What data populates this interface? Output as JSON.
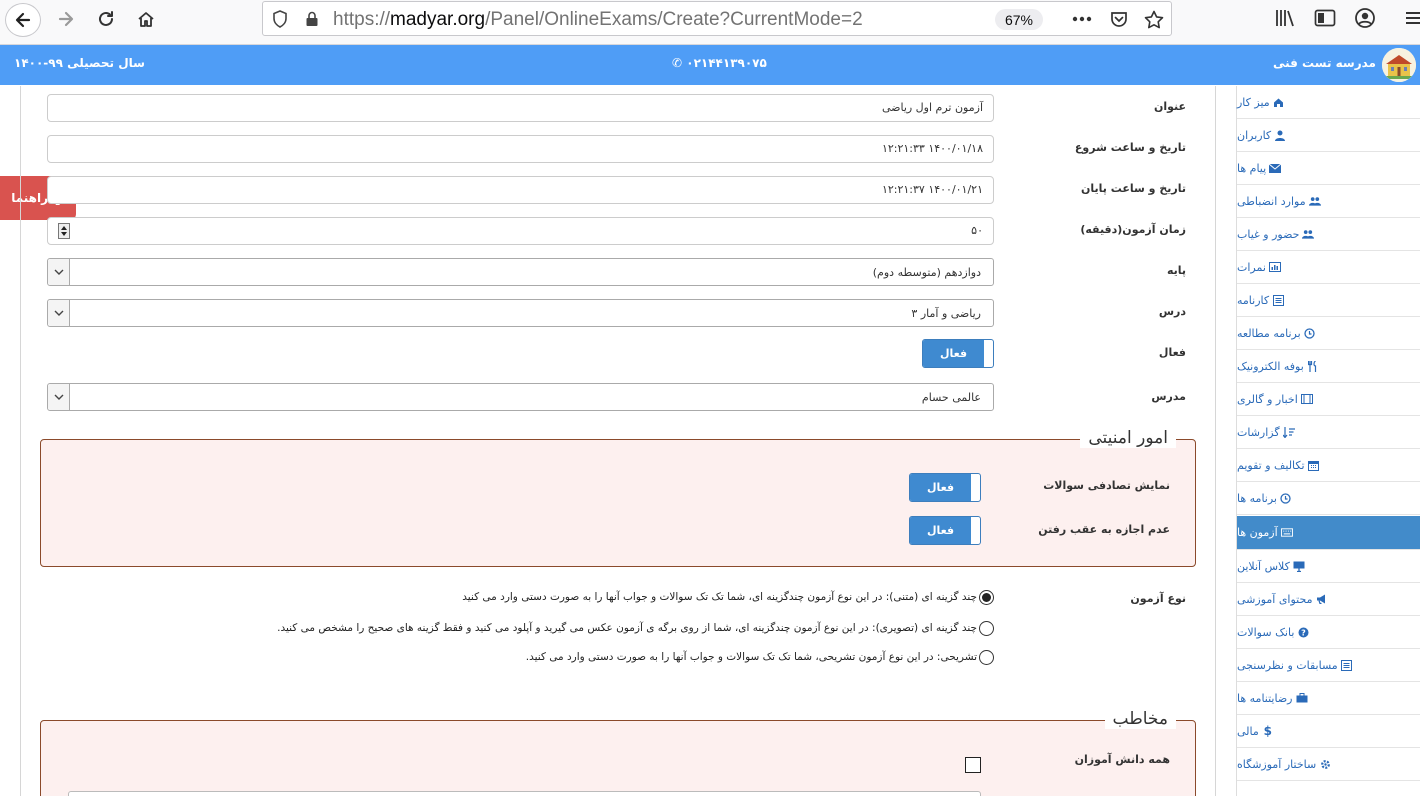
{
  "browser": {
    "url_prefix": "https://",
    "url_host": "madyar.org",
    "url_path": "/Panel/OnlineExams/Create?CurrentMode=2",
    "zoom": "67%"
  },
  "header": {
    "school_name": "مدرسه تست فنی",
    "phone": "۰۲۱۴۴۱۳۹۰۷۵",
    "academic_year": "سال تحصیلی ۹۹-۱۴۰۰"
  },
  "help": {
    "label": "راهنما"
  },
  "sidebar": {
    "items": [
      {
        "label": "میز کار",
        "icon": "home-icon"
      },
      {
        "label": "کاربران",
        "icon": "user-icon"
      },
      {
        "label": "پیام ها",
        "icon": "envelope-icon"
      },
      {
        "label": "موارد انضباطی",
        "icon": "users-icon"
      },
      {
        "label": "حضور و غیاب",
        "icon": "users-icon"
      },
      {
        "label": "نمرات",
        "icon": "bar-chart-icon"
      },
      {
        "label": "کارنامه",
        "icon": "list-icon"
      },
      {
        "label": "برنامه مطالعه",
        "icon": "clock-icon"
      },
      {
        "label": "بوفه الکترونیک",
        "icon": "cutlery-icon"
      },
      {
        "label": "اخبار و گالری",
        "icon": "film-icon"
      },
      {
        "label": "گزارشات",
        "icon": "sort-icon"
      },
      {
        "label": "تکالیف و تقویم",
        "icon": "calendar-icon"
      },
      {
        "label": "برنامه ها",
        "icon": "clock-icon"
      },
      {
        "label": "آزمون ها",
        "icon": "keyboard-icon",
        "active": true
      },
      {
        "label": "کلاس آنلاین",
        "icon": "desktop-icon"
      },
      {
        "label": "محتوای آموزشی",
        "icon": "bullhorn-icon"
      },
      {
        "label": "بانک سوالات",
        "icon": "question-icon"
      },
      {
        "label": "مسابقات و نظرسنجی",
        "icon": "list-icon"
      },
      {
        "label": "رضایتنامه ها",
        "icon": "briefcase-icon"
      },
      {
        "label": "مالی",
        "icon": "dollar-icon"
      },
      {
        "label": "ساختار آموزشگاه",
        "icon": "gear-icon"
      }
    ]
  },
  "form": {
    "title": {
      "label": "عنوان",
      "value": "آزمون ترم اول ریاضی"
    },
    "start": {
      "label": "تاریخ و ساعت شروع",
      "value": "۱۴۰۰/۰۱/۱۸ ۱۲:۲۱:۳۳"
    },
    "end": {
      "label": "تاریخ و ساعت پایان",
      "value": "۱۴۰۰/۰۱/۲۱ ۱۲:۲۱:۳۷"
    },
    "duration": {
      "label": "زمان آزمون(دقیقه)",
      "value": "۵۰"
    },
    "grade": {
      "label": "پایه",
      "value": "دوازدهم (متوسطه دوم)"
    },
    "lesson": {
      "label": "درس",
      "value": "ریاضی و آمار ۳"
    },
    "active": {
      "label": "فعال",
      "toggle": "فعال"
    },
    "teacher": {
      "label": "مدرس",
      "value": "عالمی حسام"
    }
  },
  "security": {
    "legend": "امور امنیتی",
    "random": {
      "label": "نمایش تصادفی سوالات",
      "toggle": "فعال"
    },
    "noback": {
      "label": "عدم اجازه به عقب رفتن",
      "toggle": "فعال"
    }
  },
  "exam_type": {
    "label": "نوع آزمون",
    "options": [
      {
        "text": "چند گزینه ای (متنی): در این نوع آزمون چندگزینه ای، شما تک تک سوالات و جواب آنها را به صورت دستی وارد می کنید",
        "checked": true
      },
      {
        "text": "چند گزینه ای (تصویری): در این نوع آزمون چندگزینه ای، شما از روی برگه ی آزمون عکس می گیرید و آپلود می کنید و فقط گزینه های صحیح را مشخص می کنید.",
        "checked": false
      },
      {
        "text": "تشریحی: در این نوع آزمون تشریحی، شما تک تک سوالات و جواب آنها را به صورت دستی وارد می کنید.",
        "checked": false
      }
    ]
  },
  "audience": {
    "legend": "مخاطب",
    "all_students": {
      "label": "همه دانش آموزان",
      "checked": false
    }
  }
}
